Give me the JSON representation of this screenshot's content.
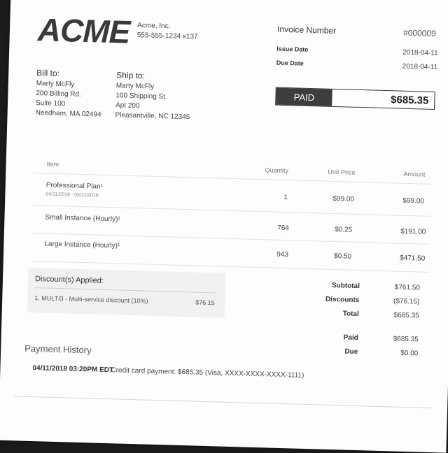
{
  "company": {
    "logo_text": "ACME",
    "name": "Acme, Inc.",
    "phone": "555-555-1234 x137"
  },
  "invoice": {
    "number_label": "Invoice Number",
    "number": "#000009",
    "issue_label": "Issue Date",
    "issue_date": "2018-04-11",
    "due_label": "Due Date",
    "due_date": "2018-04-11",
    "status": "PAID",
    "amount": "$685.35"
  },
  "bill_to": {
    "label": "Bill to:",
    "lines": [
      "Marty McFly",
      "200 Billing Rd.",
      "Suite 100",
      "Needham, MA 02494"
    ]
  },
  "ship_to": {
    "label": "Ship to:",
    "lines": [
      "Marty McFly",
      "100 Shipping St.",
      "Apt 200",
      "Pleasantville, NC 12345"
    ]
  },
  "table": {
    "headers": [
      "Item",
      "Quantity",
      "Unit Price",
      "Amount"
    ],
    "rows": [
      {
        "item": "Professional Plan¹",
        "sub": "04/11/2018 - 05/11/2018",
        "qty": "1",
        "unit": "$99.00",
        "amount": "$99.00"
      },
      {
        "item": "Small Instance (Hourly)¹",
        "sub": "",
        "qty": "764",
        "unit": "$0.25",
        "amount": "$191.00"
      },
      {
        "item": "Large Instance (Hourly)¹",
        "sub": "",
        "qty": "943",
        "unit": "$0.50",
        "amount": "$471.50"
      }
    ]
  },
  "discounts": {
    "title": "Discount(s) Applied:",
    "items": [
      {
        "label": "1. MULTI3 - Multi-service discount (10%)",
        "amount": "$76.15"
      }
    ]
  },
  "summary": [
    {
      "label": "Subtotal",
      "value": "$761.50"
    },
    {
      "label": "Discounts",
      "value": "($76.15)"
    },
    {
      "label": "Total",
      "value": "$685.35"
    },
    {
      "label": "Paid",
      "value": "$685.35"
    },
    {
      "label": "Due",
      "value": "$0.00"
    }
  ],
  "payment_history": {
    "title": "Payment History",
    "entries": [
      {
        "date": "04/11/2018 03:20PM EDT",
        "desc": "Credit card payment: $685.35 (Visa, XXXX-XXXX-XXXX-1111)"
      }
    ]
  }
}
